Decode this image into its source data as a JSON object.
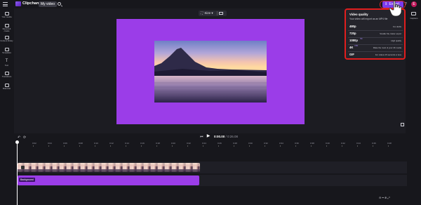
{
  "app": {
    "brand": "Clipchamp",
    "project_name": "My video",
    "export_label": "Export",
    "avatar_initial": "E"
  },
  "sidebar": {
    "items": [
      {
        "label": "Your media",
        "icon": "folder-icon"
      },
      {
        "label": "Record & create",
        "icon": "record-icon"
      },
      {
        "label": "Content library",
        "icon": "library-icon"
      },
      {
        "label": "Templates",
        "icon": "templates-icon"
      },
      {
        "label": "Text",
        "icon": "text-icon"
      },
      {
        "label": "Transitions",
        "icon": "transitions-icon"
      },
      {
        "label": "Brand kit",
        "icon": "brand-kit-icon"
      }
    ]
  },
  "rail": {
    "captions_label": "Captions"
  },
  "preview": {
    "size_label": "Size",
    "canvas_color": "#9b3de8"
  },
  "playback": {
    "current_time": "0:00.00",
    "separator": " / ",
    "total_time": "0:26.08"
  },
  "timeline": {
    "ticks": [
      "0:02",
      "0:04",
      "0:06",
      "0:08",
      "0:10",
      "0:12",
      "0:14",
      "0:16",
      "0:18",
      "0:20",
      "0:22",
      "0:24",
      "0:26",
      "0:28",
      "0:30",
      "0:32",
      "0:34",
      "0:36",
      "0:38",
      "0:40",
      "0:42",
      "0:44",
      "0:46",
      "0:48",
      "0:50"
    ],
    "background_clip_label": "Background"
  },
  "export_panel": {
    "title": "Video quality",
    "subtitle": "Your video will export as an MP4 file",
    "options": [
      {
        "name": "480p",
        "badge": "",
        "desc": "For drafts"
      },
      {
        "name": "720p",
        "badge": "",
        "desc": "Smaller file, faster export"
      },
      {
        "name": "1080p",
        "badge": "HD",
        "desc": "High quality"
      },
      {
        "name": "4K",
        "badge": "UHD",
        "desc": "Make the most of your 4K media"
      },
      {
        "name": "GIF",
        "badge": "",
        "desc": "For videos 15 seconds or less"
      }
    ]
  },
  "colors": {
    "accent": "#7c3aed",
    "highlight_red": "#e01e1e",
    "background_clip": "#9b3de8"
  }
}
